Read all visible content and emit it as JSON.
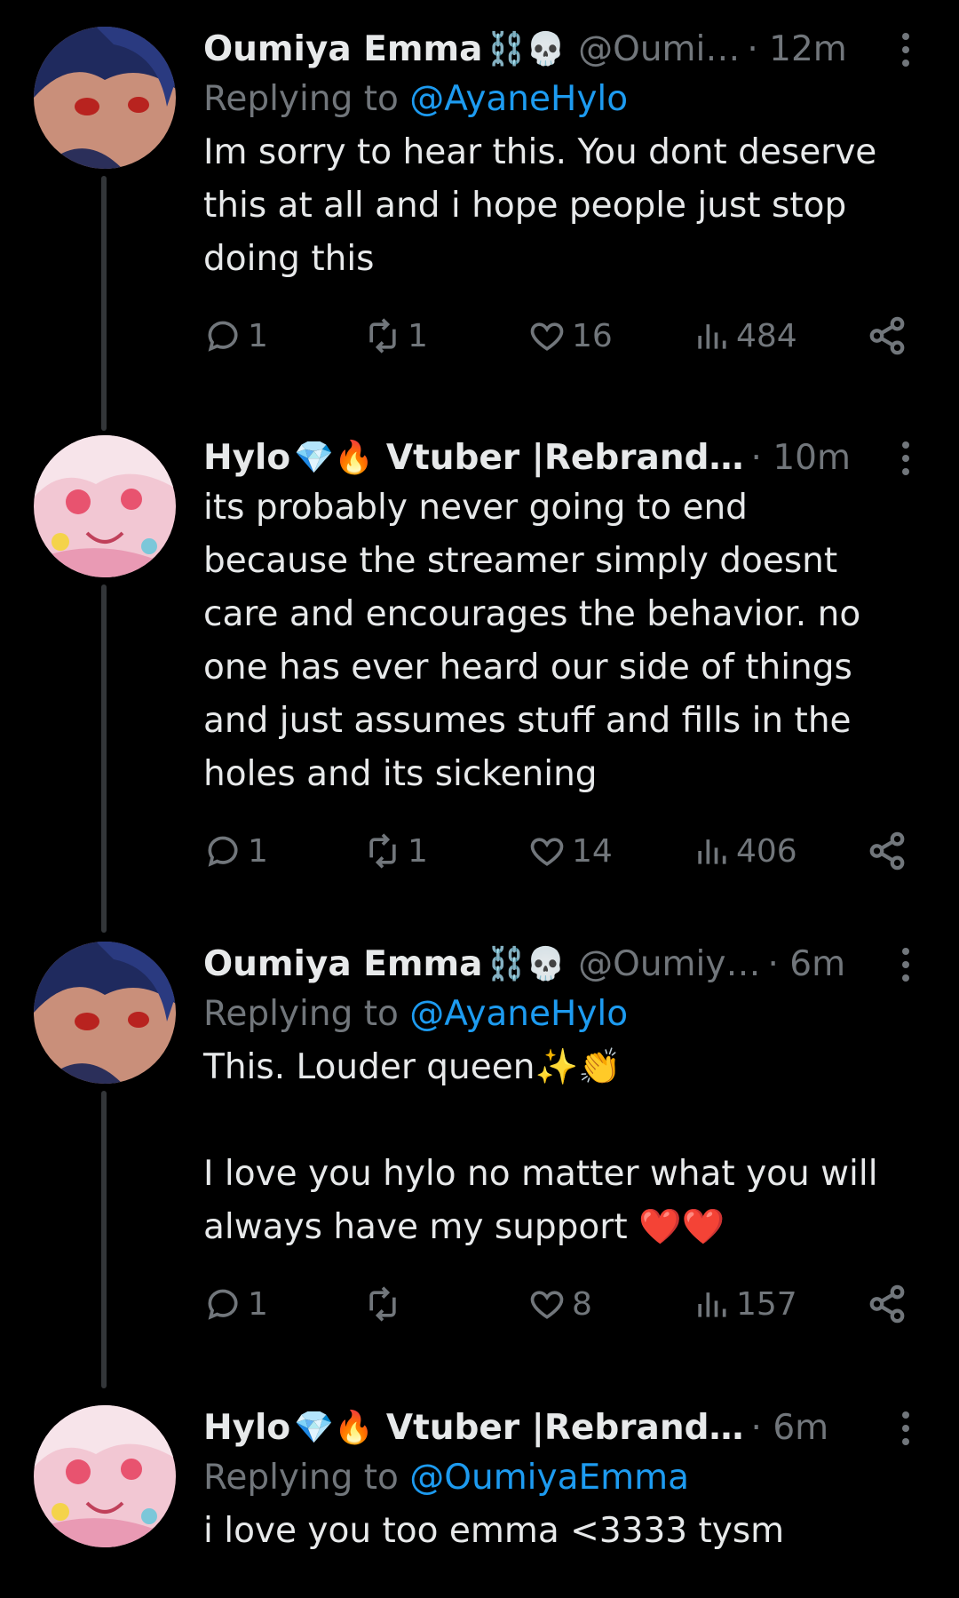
{
  "tweets": [
    {
      "author": {
        "name": "Oumiya Emma",
        "badges": "⛓️💀",
        "handle": "@Oumi…",
        "avatar": "emma"
      },
      "time": "· 12m",
      "reply_prefix": "Replying to ",
      "reply_to": "@AyaneHylo",
      "text": "Im sorry to hear this. You dont deserve\nthis at all and i hope people just stop\ndoing this",
      "stats": {
        "replies": "1",
        "reposts": "1",
        "likes": "16",
        "views": "484"
      }
    },
    {
      "author": {
        "name": "Hylo",
        "badges": "💎🔥",
        "handle": "Vtuber |Rebrand…",
        "avatar": "hylo"
      },
      "time": "· 10m",
      "reply_prefix": "",
      "reply_to": "",
      "text": "its probably never going to end\nbecause the streamer simply doesnt\ncare and encourages the behavior. no\none has ever heard our side of things\nand just assumes stuff and fills in the\nholes and its sickening",
      "stats": {
        "replies": "1",
        "reposts": "1",
        "likes": "14",
        "views": "406"
      }
    },
    {
      "author": {
        "name": "Oumiya Emma",
        "badges": "⛓️💀",
        "handle": "@Oumiy…",
        "avatar": "emma"
      },
      "time": "· 6m",
      "reply_prefix": "Replying to ",
      "reply_to": "@AyaneHylo",
      "text": "This. Louder queen✨👏\n\nI love you hylo no matter what you will\nalways have my support ❤️❤️",
      "stats": {
        "replies": "1",
        "reposts": "",
        "likes": "8",
        "views": "157"
      }
    },
    {
      "author": {
        "name": "Hylo",
        "badges": "💎🔥",
        "handle": "Vtuber |Rebrand…",
        "avatar": "hylo"
      },
      "time": "· 6m",
      "reply_prefix": "Replying to ",
      "reply_to": "@OumiyaEmma",
      "text": "i love you too emma <3333 tysm",
      "stats": null
    }
  ],
  "colors": {
    "background": "#000000",
    "text": "#e7e9ea",
    "muted": "#71767b",
    "link": "#1d9bf0",
    "thread_line": "#333639"
  }
}
